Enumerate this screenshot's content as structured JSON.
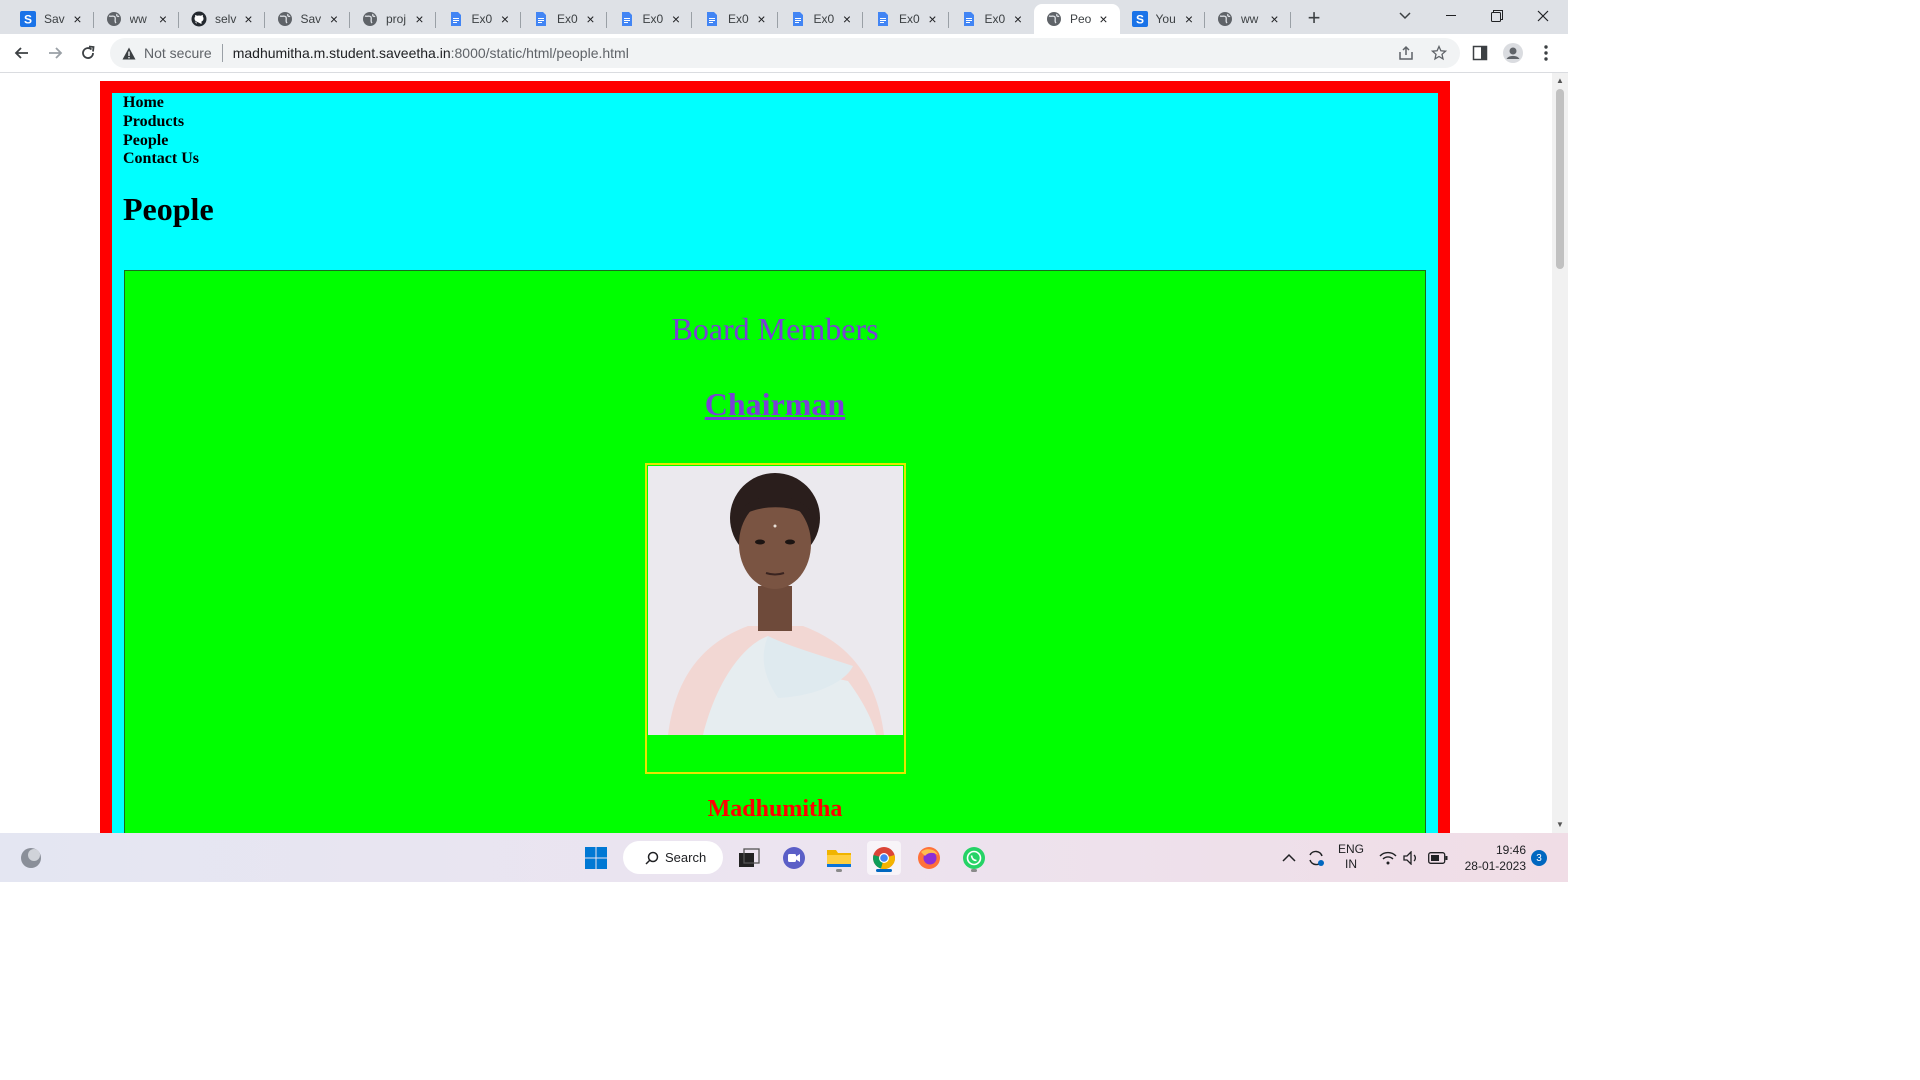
{
  "browser": {
    "tabs": [
      {
        "title": "Sav",
        "icon": "s-site-icon"
      },
      {
        "title": "ww",
        "icon": "globe-icon"
      },
      {
        "title": "selv",
        "icon": "github-icon"
      },
      {
        "title": "Sav",
        "icon": "globe-icon"
      },
      {
        "title": "proj",
        "icon": "globe-icon"
      },
      {
        "title": "Ex0",
        "icon": "docs-icon"
      },
      {
        "title": "Ex0",
        "icon": "docs-icon"
      },
      {
        "title": "Ex0",
        "icon": "docs-icon"
      },
      {
        "title": "Ex0",
        "icon": "docs-icon"
      },
      {
        "title": "Ex0",
        "icon": "docs-icon"
      },
      {
        "title": "Ex0",
        "icon": "docs-icon"
      },
      {
        "title": "Ex0",
        "icon": "docs-icon"
      },
      {
        "title": "Peo",
        "icon": "globe-icon",
        "active": true
      },
      {
        "title": "You",
        "icon": "s-site-icon"
      },
      {
        "title": "ww",
        "icon": "globe-icon"
      }
    ],
    "new_tab": "+",
    "security_label": "Not secure",
    "url_host": "madhumitha.m.student.saveetha.in",
    "url_path": ":8000/static/html/people.html"
  },
  "page": {
    "nav": [
      "Home",
      "Products",
      "People",
      "Contact Us"
    ],
    "title": "People",
    "section_title": "Board Members",
    "role": "Chairman",
    "member_name": "Madhumitha",
    "colors": {
      "outer_border": "#ff0000",
      "inner_bg": "#00ffff",
      "content_bg": "#00ff00",
      "heading_purple": "#7b3fd6",
      "name_red": "#ff0000",
      "photo_border": "#e6e600"
    }
  },
  "taskbar": {
    "search_label": "Search",
    "lang_line1": "ENG",
    "lang_line2": "IN",
    "time": "19:46",
    "date": "28-01-2023",
    "notification_count": "3"
  }
}
